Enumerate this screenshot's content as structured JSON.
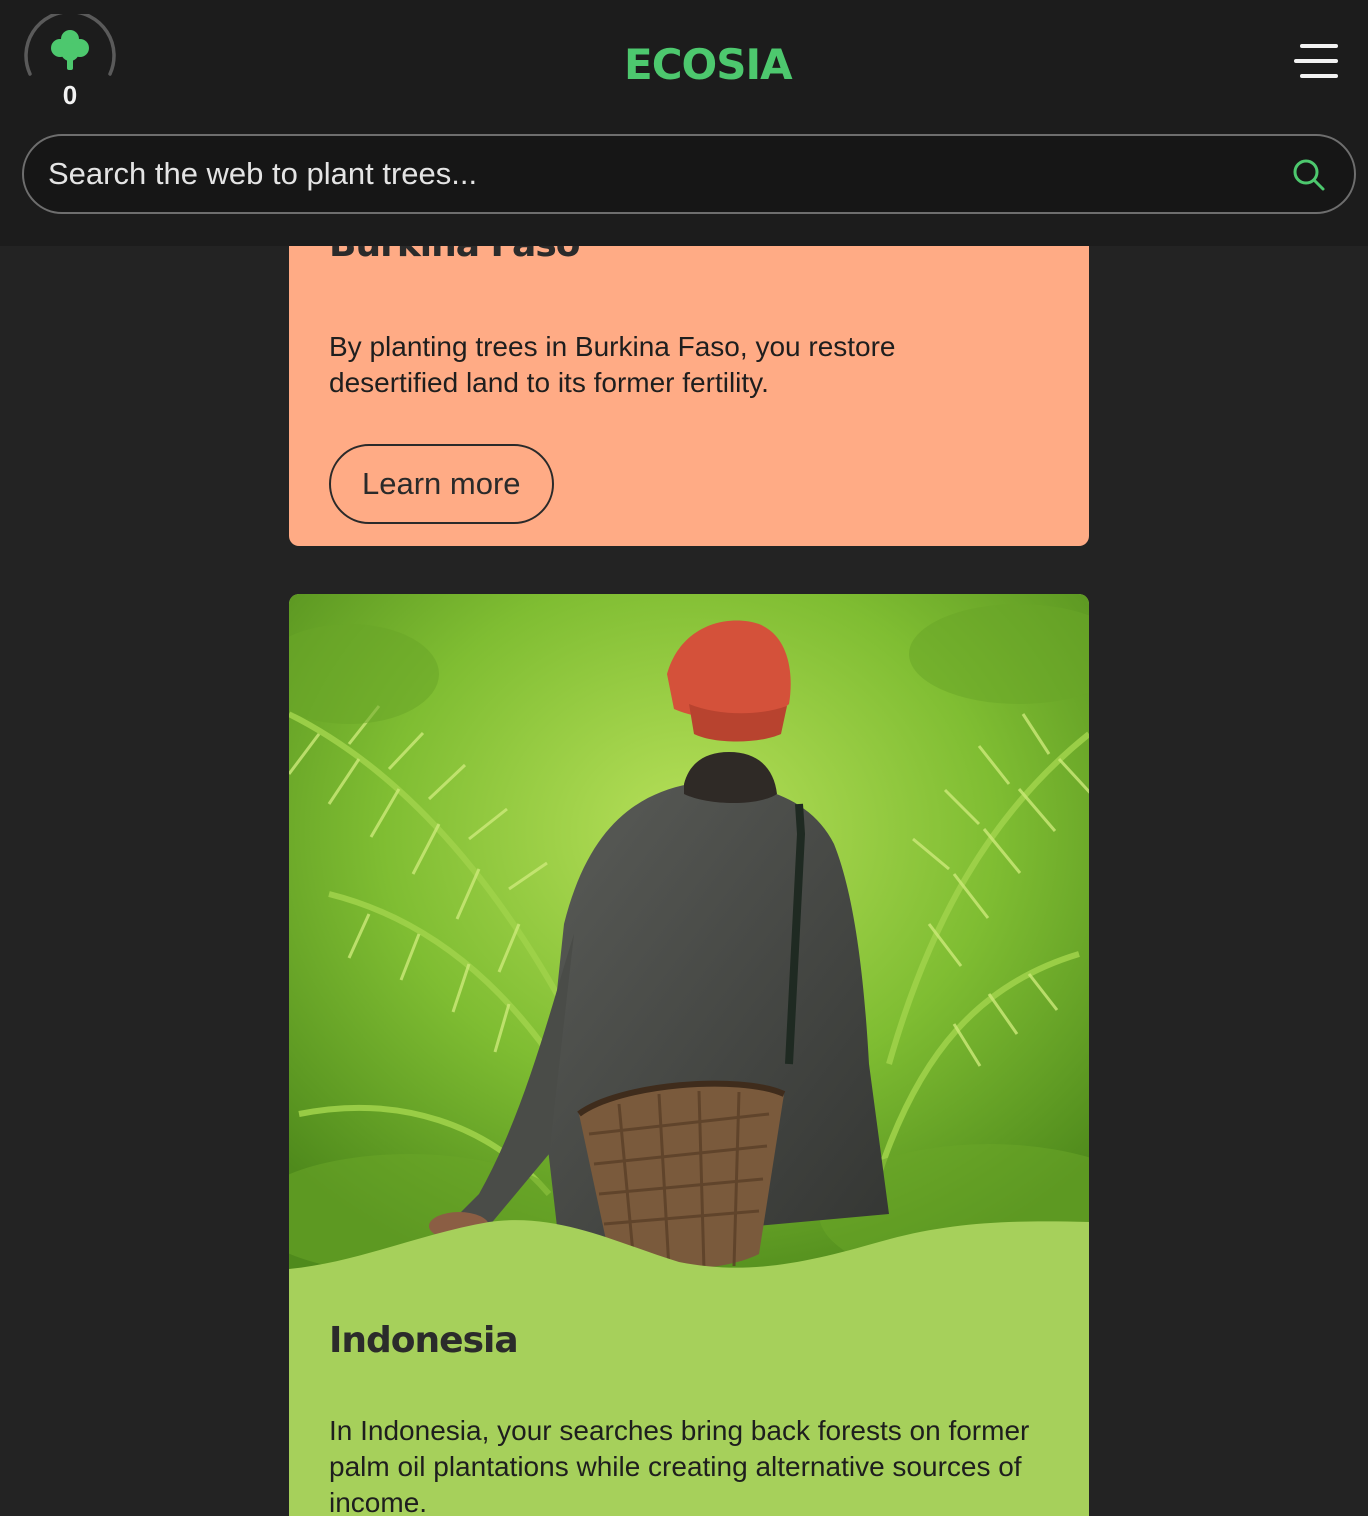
{
  "header": {
    "tree_count": "0",
    "logo": "ECOSIA",
    "search_placeholder": "Search the web to plant trees..."
  },
  "cards": [
    {
      "title": "Burkina Faso",
      "body": "By planting trees in Burkina Faso, you restore desertified land to its former fertility.",
      "button": "Learn more",
      "color": "#ffab85"
    },
    {
      "title": "Indonesia",
      "body": "In Indonesia, your searches bring back forests on former palm oil plantations while creating alternative sources of income.",
      "color": "#a6d05b",
      "image": "person-with-basket-in-fern-forest"
    }
  ],
  "colors": {
    "brand_green": "#4dc86e",
    "header_bg": "#1c1c1c",
    "page_bg": "#232323"
  }
}
